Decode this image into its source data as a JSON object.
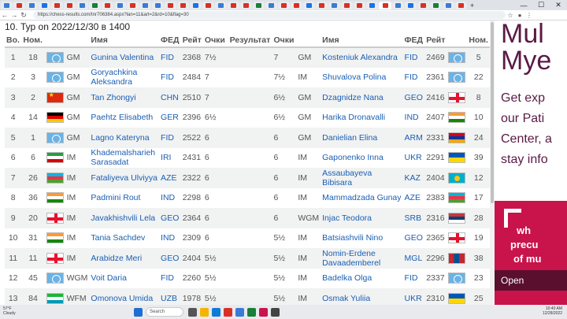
{
  "browser": {
    "url": "https://chess-results.com/tnr706384.aspx?lan=11&art=2&rd=10&flag=30",
    "tab_colors": [
      "#3a7bd5",
      "#d93025",
      "#3a7bd5",
      "#1a73e8",
      "#d93025",
      "#d93025",
      "#3a7bd5",
      "#188038",
      "#d93025",
      "#3a7bd5",
      "#d93025",
      "#3a7bd5",
      "#3a7bd5",
      "#d93025",
      "#d93025",
      "#1a73e8",
      "#d93025",
      "#3a7bd5",
      "#d93025",
      "#d93025",
      "#188038",
      "#3a7bd5",
      "#d93025",
      "#d93025",
      "#1a73e8",
      "#d93025",
      "#3a7bd5",
      "#d93025",
      "#d93025",
      "#1a73e8",
      "#d93025",
      "#3a7bd5",
      "#1a73e8",
      "#d93025",
      "#188038",
      "#3a7bd5",
      "#d93025"
    ],
    "close_tab": "✕",
    "new_tab": "+",
    "win_min": "—",
    "win_max": "☐",
    "win_close": "✕"
  },
  "round_title": "10. Тур on 2022/12/30 в 1400",
  "table": {
    "headers": {
      "no": "Во.",
      "rank": "Ном.",
      "name": "Имя",
      "fed": "ФЕД",
      "rating": "Рейт",
      "points": "Очки",
      "result": "Результат",
      "points2": "Очки",
      "name2": "Имя",
      "fed2": "ФЕД",
      "rating2": "Рейт",
      "rank2": "Ном."
    },
    "rows": [
      {
        "no": "1",
        "rk": "18",
        "flag": "fid",
        "ti": "GM",
        "nm": "Gunina Valentina",
        "fd": "FID",
        "rt": "2368",
        "pt": "7½",
        "res": "",
        "pt2": "7",
        "ti2": "GM",
        "nm2": "Kosteniuk Alexandra",
        "fd2": "FID",
        "rt2": "2469",
        "flag2": "fid",
        "rk2": "5"
      },
      {
        "no": "2",
        "rk": "3",
        "flag": "fid",
        "ti": "GM",
        "nm": "Goryachkina Aleksandra",
        "fd": "FID",
        "rt": "2484",
        "pt": "7",
        "res": "",
        "pt2": "7½",
        "ti2": "IM",
        "nm2": "Shuvalova Polina",
        "fd2": "FID",
        "rt2": "2361",
        "flag2": "fid",
        "rk2": "22"
      },
      {
        "no": "3",
        "rk": "2",
        "flag": "chn",
        "ti": "GM",
        "nm": "Tan Zhongyi",
        "fd": "CHN",
        "rt": "2510",
        "pt": "7",
        "res": "",
        "pt2": "6½",
        "ti2": "GM",
        "nm2": "Dzagnidze Nana",
        "fd2": "GEO",
        "rt2": "2416",
        "flag2": "geo",
        "rk2": "8"
      },
      {
        "no": "4",
        "rk": "14",
        "flag": "ger",
        "ti": "GM",
        "nm": "Paehtz Elisabeth",
        "fd": "GER",
        "rt": "2396",
        "pt": "6½",
        "res": "",
        "pt2": "6½",
        "ti2": "GM",
        "nm2": "Harika Dronavalli",
        "fd2": "IND",
        "rt2": "2407",
        "flag2": "ind",
        "rk2": "10"
      },
      {
        "no": "5",
        "rk": "1",
        "flag": "fid",
        "ti": "GM",
        "nm": "Lagno Kateryna",
        "fd": "FID",
        "rt": "2522",
        "pt": "6",
        "res": "",
        "pt2": "6",
        "ti2": "GM",
        "nm2": "Danielian Elina",
        "fd2": "ARM",
        "rt2": "2331",
        "flag2": "arm",
        "rk2": "24"
      },
      {
        "no": "6",
        "rk": "6",
        "flag": "iri",
        "ti": "IM",
        "nm": "Khademalsharieh Sarasadat",
        "fd": "IRI",
        "rt": "2431",
        "pt": "6",
        "res": "",
        "pt2": "6",
        "ti2": "IM",
        "nm2": "Gaponenko Inna",
        "fd2": "UKR",
        "rt2": "2291",
        "flag2": "ukr",
        "rk2": "39"
      },
      {
        "no": "7",
        "rk": "26",
        "flag": "aze",
        "ti": "IM",
        "nm": "Fataliyeva Ulviyya",
        "fd": "AZE",
        "rt": "2322",
        "pt": "6",
        "res": "",
        "pt2": "6",
        "ti2": "IM",
        "nm2": "Assaubayeva Bibisara",
        "fd2": "KAZ",
        "rt2": "2404",
        "flag2": "kaz",
        "rk2": "12"
      },
      {
        "no": "8",
        "rk": "36",
        "flag": "ind",
        "ti": "IM",
        "nm": "Padmini Rout",
        "fd": "IND",
        "rt": "2298",
        "pt": "6",
        "res": "",
        "pt2": "6",
        "ti2": "IM",
        "nm2": "Mammadzada Gunay",
        "fd2": "AZE",
        "rt2": "2383",
        "flag2": "aze",
        "rk2": "17"
      },
      {
        "no": "9",
        "rk": "20",
        "flag": "geo",
        "ti": "IM",
        "nm": "Javakhishvili Lela",
        "fd": "GEO",
        "rt": "2364",
        "pt": "6",
        "res": "",
        "pt2": "6",
        "ti2": "WGM",
        "nm2": "Injac Teodora",
        "fd2": "SRB",
        "rt2": "2316",
        "flag2": "srb",
        "rk2": "28"
      },
      {
        "no": "10",
        "rk": "31",
        "flag": "ind",
        "ti": "IM",
        "nm": "Tania Sachdev",
        "fd": "IND",
        "rt": "2309",
        "pt": "6",
        "res": "",
        "pt2": "5½",
        "ti2": "IM",
        "nm2": "Batsiashvili Nino",
        "fd2": "GEO",
        "rt2": "2365",
        "flag2": "geo",
        "rk2": "19"
      },
      {
        "no": "11",
        "rk": "11",
        "flag": "geo",
        "ti": "IM",
        "nm": "Arabidze Meri",
        "fd": "GEO",
        "rt": "2404",
        "pt": "5½",
        "res": "",
        "pt2": "5½",
        "ti2": "IM",
        "nm2": "Nomin-Erdene Davaademberel",
        "fd2": "MGL",
        "rt2": "2296",
        "flag2": "mgl",
        "rk2": "38"
      },
      {
        "no": "12",
        "rk": "45",
        "flag": "fid",
        "ti": "WGM",
        "nm": "Voit Daria",
        "fd": "FID",
        "rt": "2260",
        "pt": "5½",
        "res": "",
        "pt2": "5½",
        "ti2": "IM",
        "nm2": "Badelka Olga",
        "fd2": "FID",
        "rt2": "2337",
        "flag2": "fid",
        "rk2": "23"
      },
      {
        "no": "13",
        "rk": "84",
        "flag": "uzb",
        "ti": "WFM",
        "nm": "Omonova Umida",
        "fd": "UZB",
        "rt": "1978",
        "pt": "5½",
        "res": "",
        "pt2": "5½",
        "ti2": "IM",
        "nm2": "Osmak Yuliia",
        "fd2": "UKR",
        "rt2": "2310",
        "flag2": "ukr",
        "rk2": "25"
      }
    ]
  },
  "ad": {
    "line1": "Mul",
    "line2": "Mye",
    "line3": "Get exp",
    "line4": "our Pati",
    "line5": "Center, a",
    "line6": "stay info",
    "line7": "wh",
    "line8": "precu",
    "line9": "of mu",
    "open": "Open",
    "top_color": "#5a1a45",
    "bottom_color": "#c8144b"
  },
  "taskbar": {
    "temp": "57°F",
    "weather": "Cloudy",
    "search": "Search",
    "time": "10:40 AM",
    "date": "12/28/2022"
  }
}
